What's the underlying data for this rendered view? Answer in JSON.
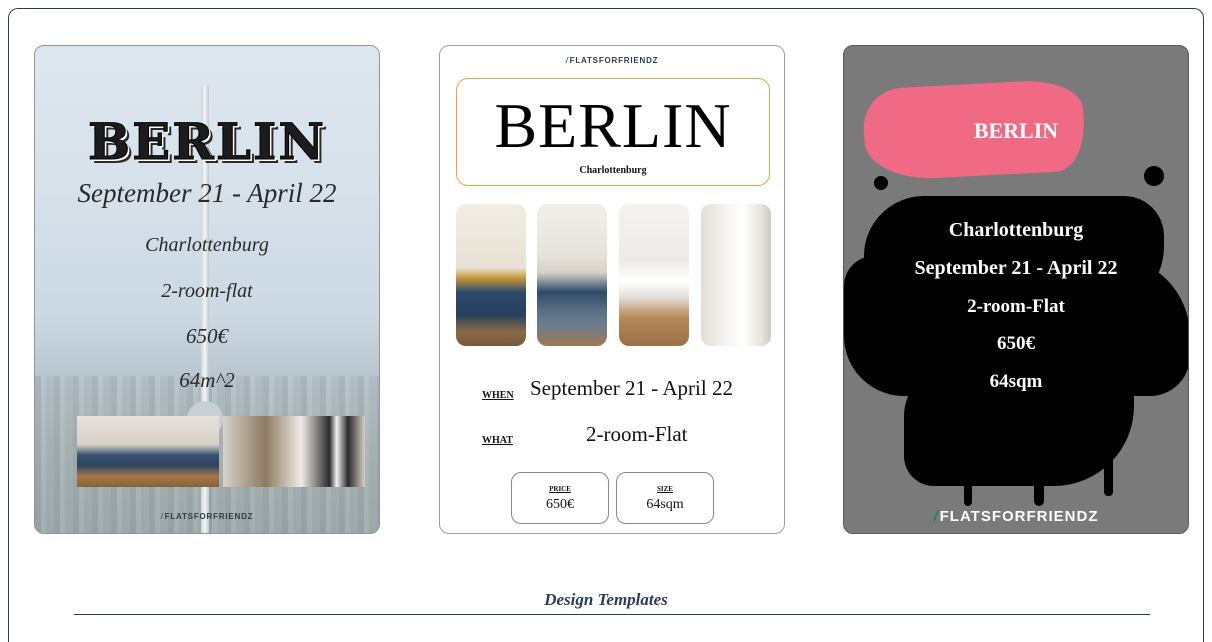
{
  "templates": [
    {
      "city": "BERLIN",
      "dates": "September 21 - April 22",
      "district": "Charlottenburg",
      "type": "2-room-flat",
      "price": "650€",
      "size": "64m^2",
      "brand": "FLATSFORFRIENDZ"
    },
    {
      "brand": "FLATSFORFRIENDZ",
      "city": "BERLIN",
      "district": "Charlottenburg",
      "when_label": "WHEN",
      "when_value": "September 21 - April 22",
      "what_label": "WHAT",
      "what_value": "2-room-Flat",
      "price_label": "PRICE",
      "price_value": "650€",
      "size_label": "SIZE",
      "size_value": "64sqm"
    },
    {
      "city": "BERLIN",
      "district": "Charlottenburg",
      "dates": "September 21 - April 22",
      "type": "2-room-Flat",
      "price": "650€",
      "size": "64sqm",
      "brand": "FLATSFORFRIENDZ"
    }
  ],
  "caption": "Design Templates",
  "colors": {
    "frame": "#2a3c4c",
    "accent_orange": "#e8a24a",
    "brush_pink": "#f06a86",
    "logo_green": "#1f8a3a"
  }
}
